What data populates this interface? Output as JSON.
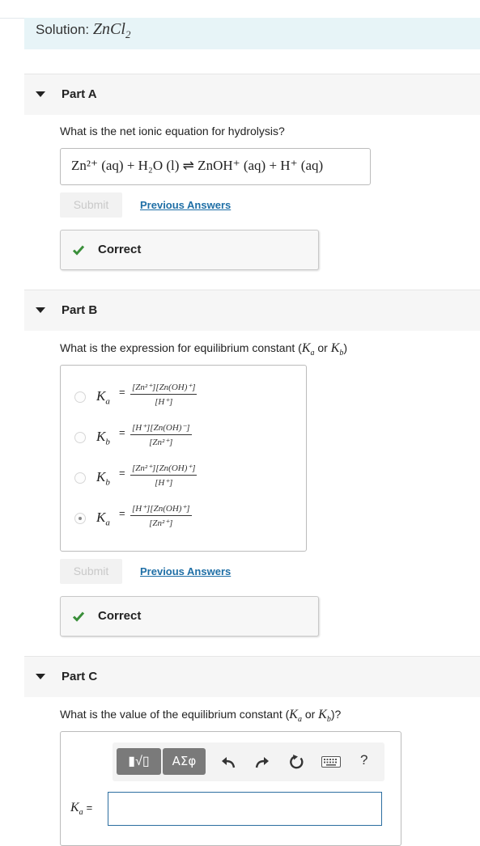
{
  "solution": {
    "label": "Solution:",
    "formula": "ZnCl",
    "formula_sub": "2"
  },
  "partA": {
    "label": "Part A",
    "question": "What is the net ionic equation for hydrolysis?",
    "answer": "Zn²⁺ (aq) + H₂O (l) ⇌ ZnOH⁺ (aq) + H⁺ (aq)",
    "submit": "Submit",
    "previous": "Previous Answers",
    "status": "Correct"
  },
  "partB": {
    "label": "Part B",
    "question_prefix": "What is the expression for equilibrium constant (",
    "question_ka": "K",
    "question_ka_sub": "a",
    "question_or": " or ",
    "question_kb": "K",
    "question_kb_sub": "b",
    "question_suffix": ")",
    "choices": [
      {
        "k": "K",
        "sub": "a",
        "eq": "=",
        "num": "[Zn²⁺][Zn(OH)⁺]",
        "den": "[H⁺]",
        "selected": false
      },
      {
        "k": "K",
        "sub": "b",
        "eq": "=",
        "num": "[H⁺][Zn(OH)⁻]",
        "den": "[Zn²⁺]",
        "selected": false
      },
      {
        "k": "K",
        "sub": "b",
        "eq": "=",
        "num": "[Zn²⁺][Zn(OH)⁺]",
        "den": "[H⁺]",
        "selected": false
      },
      {
        "k": "K",
        "sub": "a",
        "eq": "=",
        "num": "[H⁺][Zn(OH)⁺]",
        "den": "[Zn²⁺]",
        "selected": true
      }
    ],
    "submit": "Submit",
    "previous": "Previous Answers",
    "status": "Correct"
  },
  "partC": {
    "label": "Part C",
    "question_prefix": "What is the value of the equilibrium constant (",
    "question_ka": "K",
    "question_ka_sub": "a",
    "question_or": " or ",
    "question_kb": "K",
    "question_kb_sub": "b",
    "question_suffix": ")?",
    "toolbar": {
      "template_label": "▮√▯",
      "greek_label": "ΑΣφ",
      "icons": [
        "undo-icon",
        "redo-icon",
        "reset-icon",
        "keyboard-icon",
        "help-icon"
      ],
      "help": "?"
    },
    "input_label_k": "K",
    "input_label_sub": "a",
    "input_eq": "=",
    "input_value": ""
  },
  "colors": {
    "banner_bg": "#e7f4f7",
    "link": "#1f6fa6",
    "check": "#3a8f3a",
    "input_border": "#2c6ea0"
  }
}
